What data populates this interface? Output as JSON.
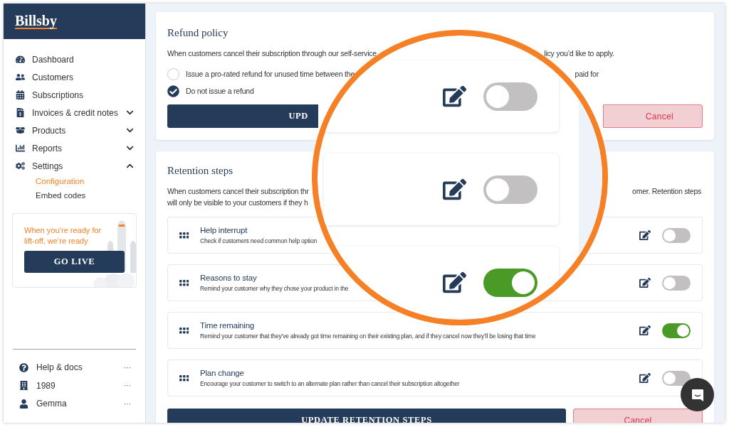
{
  "sidebar": {
    "logo": "Billsby",
    "nav": [
      {
        "kind": "link",
        "label": "Dashboard"
      },
      {
        "kind": "link",
        "label": "Customers"
      },
      {
        "kind": "link",
        "label": "Subscriptions"
      },
      {
        "kind": "group",
        "label": "Invoices & credit notes",
        "expanded": false
      },
      {
        "kind": "group",
        "label": "Products",
        "expanded": false
      },
      {
        "kind": "group",
        "label": "Reports",
        "expanded": false
      },
      {
        "kind": "group",
        "label": "Settings",
        "expanded": true,
        "children": [
          {
            "label": "Configuration",
            "selected": true
          },
          {
            "label": "Embed codes",
            "selected": false
          }
        ]
      }
    ],
    "promo": {
      "text": "When you’re ready for lift-off, we’re ready",
      "button": "GO LIVE"
    },
    "footer": [
      {
        "label": "Help & docs",
        "more": "···"
      },
      {
        "label": "1989",
        "more": "···"
      },
      {
        "label": "Gemma",
        "more": "···"
      }
    ]
  },
  "refund_policy": {
    "title": "Refund policy",
    "description_left": "When customers cancel their subscription through our self-service",
    "description_right": "licy you’d like to apply.",
    "options": [
      {
        "label_left": "Issue a pro-rated refund for unused time between the",
        "label_right": "paid for",
        "selected": false
      },
      {
        "label_left": "Do not issue a refund",
        "selected": true
      }
    ],
    "update_button": "UPD",
    "cancel_button": "Cancel"
  },
  "retention_steps": {
    "title": "Retention steps",
    "description_line1": "When customers cancel their subscription thr",
    "description_line1_right": "omer. Retention steps",
    "description_line2": "will only be visible to your customers if they h",
    "steps": [
      {
        "title": "Help interrupt",
        "description": "Check if customers need common help option",
        "on": false
      },
      {
        "title": "Reasons to stay",
        "description": "Remind your customer why they chose your product in the",
        "on": false
      },
      {
        "title": "Time remaining",
        "description": "Remind your customer that they’ve already got time remaining on their existing plan, and if they cancel now they’ll be losing that time",
        "on": true
      },
      {
        "title": "Plan change",
        "description": "Encourage your customer to switch to an alternate plan rather than cancel their subscription altogether",
        "on": false
      }
    ],
    "update_button": "UPDATE RETENTION STEPS",
    "cancel_button": "Cancel"
  },
  "magnifier": {
    "rows": [
      {
        "on": false
      },
      {
        "on": false
      },
      {
        "on": true
      }
    ]
  }
}
